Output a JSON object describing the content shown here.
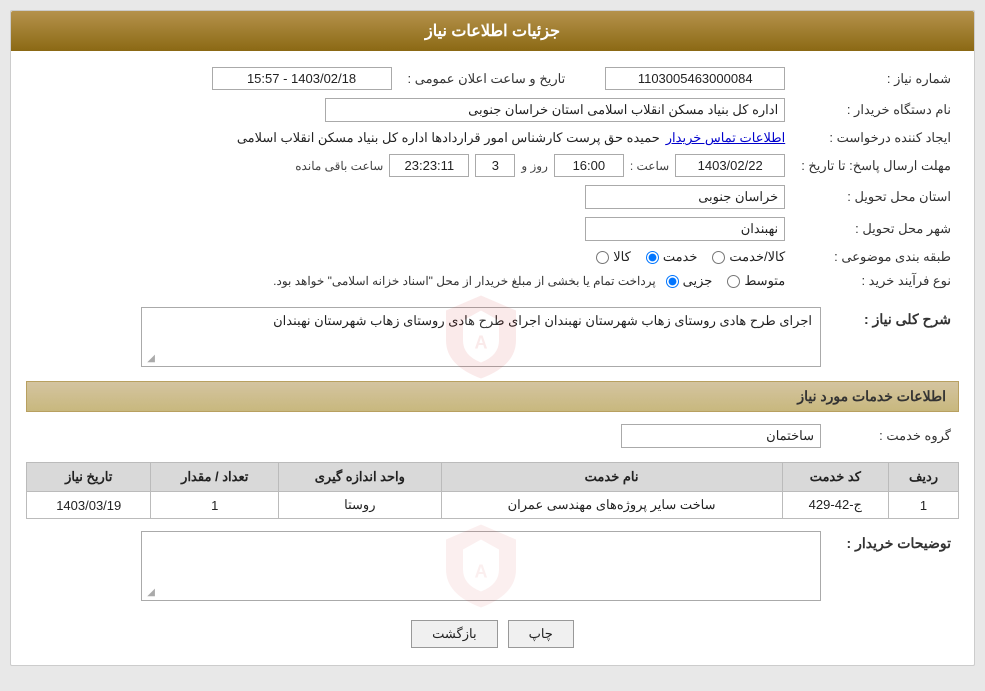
{
  "header": {
    "title": "جزئیات اطلاعات نیاز"
  },
  "info_rows": {
    "request_number_label": "شماره نیاز :",
    "request_number_value": "1103005463000084",
    "buyer_org_label": "نام دستگاه خریدار :",
    "buyer_org_value": "اداره کل بنیاد مسکن انقلاب اسلامی استان خراسان جنوبی",
    "requester_label": "ایجاد کننده درخواست :",
    "requester_value": "حمیده حق پرست کارشناس امور قراردادها اداره کل بنیاد مسکن انقلاب اسلامی",
    "contact_link": "اطلاعات تماس خریدار",
    "announce_datetime_label": "تاریخ و ساعت اعلان عمومی :",
    "announce_datetime_value": "1403/02/18 - 15:57",
    "deadline_label": "مهلت ارسال پاسخ: تا تاریخ :",
    "deadline_date": "1403/02/22",
    "deadline_time_label": "ساعت :",
    "deadline_time_value": "16:00",
    "remaining_days_label": "روز و",
    "remaining_days_value": "3",
    "remaining_time_label": "ساعت باقی مانده",
    "remaining_time_value": "23:23:11",
    "province_label": "استان محل تحویل :",
    "province_value": "خراسان جنوبی",
    "city_label": "شهر محل تحویل :",
    "city_value": "نهبندان",
    "category_label": "طبقه بندی موضوعی :",
    "category_options": [
      "کالا",
      "خدمت",
      "کالا/خدمت"
    ],
    "category_selected": "خدمت",
    "purchase_type_label": "نوع فرآیند خرید :",
    "purchase_type_options": [
      "جزیی",
      "متوسط"
    ],
    "purchase_type_note": "پرداخت تمام یا بخشی از مبلغ خریدار از محل \"اسناد خزانه اسلامی\" خواهد بود.",
    "description_label": "شرح کلی نیاز :",
    "description_value": "اجرای طرح هادی روستای  زهاب شهرستان نهبندان"
  },
  "services_section": {
    "title": "اطلاعات خدمات مورد نیاز",
    "service_group_label": "گروه خدمت :",
    "service_group_value": "ساختمان",
    "table_headers": [
      "ردیف",
      "کد خدمت",
      "نام خدمت",
      "واحد اندازه گیری",
      "تعداد / مقدار",
      "تاریخ نیاز"
    ],
    "table_rows": [
      {
        "row_num": "1",
        "code": "ج-42-429",
        "name": "ساخت سایر پروژه‌های مهندسی عمران",
        "unit": "روستا",
        "quantity": "1",
        "date": "1403/03/19"
      }
    ]
  },
  "buyer_desc": {
    "label": "توضیحات خریدار :",
    "value": ""
  },
  "buttons": {
    "print": "چاپ",
    "back": "بازگشت"
  }
}
